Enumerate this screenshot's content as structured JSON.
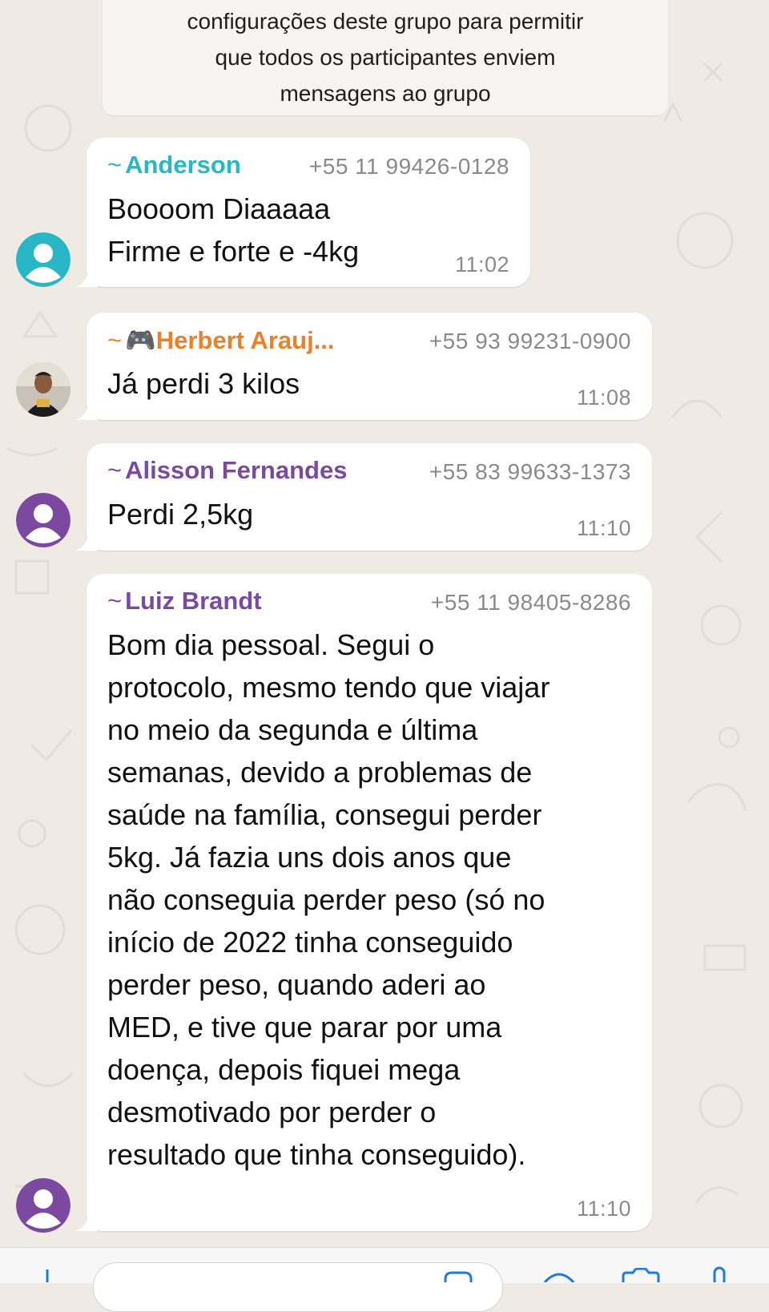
{
  "colors": {
    "bubble_bg": "#ffffff",
    "chat_bg": "#efebe4",
    "name_teal": "#29b6c5",
    "name_orange": "#e8822a",
    "name_purple": "#7b4aa0",
    "icon_blue": "#1f7ae0"
  },
  "system_message": {
    "lines": [
      "configurações deste grupo para permitir",
      "que todos os participantes enviem",
      "mensagens ao grupo"
    ]
  },
  "messages": [
    {
      "sender_prefix": "~",
      "sender": "Anderson",
      "phone": "+55 11 99426-0128",
      "lines": [
        "Boooom Diaaaaa",
        "Firme e forte e -4kg"
      ],
      "time": "11:02",
      "avatar": "default-avatar-teal-icon"
    },
    {
      "sender_prefix": "~",
      "sender_emoji": "🎮",
      "sender": "Herbert Arauj...",
      "phone": "+55 93 99231-0900",
      "lines": [
        "Já perdi 3 kilos"
      ],
      "time": "11:08",
      "avatar": "profile-photo"
    },
    {
      "sender_prefix": "~",
      "sender": "Alisson Fernandes",
      "phone": "+55 83 99633-1373",
      "lines": [
        "Perdi 2,5kg"
      ],
      "time": "11:10",
      "avatar": "default-avatar-purple-icon"
    },
    {
      "sender_prefix": "~",
      "sender": "Luiz Brandt",
      "phone": "+55 11 98405-8286",
      "lines": [
        "Bom dia pessoal. Segui o",
        "protocolo, mesmo tendo que viajar",
        "no meio da segunda e última",
        "semanas, devido a problemas de",
        "saúde na família, consegui perder",
        "5kg. Já fazia uns dois anos que",
        "não conseguia perder peso (só no",
        "início de 2022 tinha conseguido",
        "perder peso, quando aderi ao",
        "MED, e tive que parar por uma",
        "doença, depois fiquei mega",
        "desmotivado por perder o",
        "resultado que tinha conseguido)."
      ],
      "time": "11:10",
      "avatar": "default-avatar-purple-icon"
    }
  ],
  "bottom_bar": {
    "icons": [
      "plus-icon",
      "sticker-icon",
      "camera-icon",
      "microphone-icon"
    ]
  }
}
